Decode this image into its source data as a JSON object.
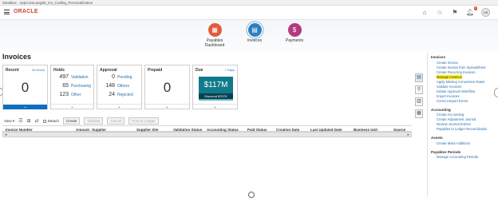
{
  "sandbox": {
    "label": "Sandbox",
    "name": "AppCoreLang3E_Inv_Coding_Personalization"
  },
  "header": {
    "logo": "ORACLE",
    "notif_count": "6",
    "avatar": "NB"
  },
  "tiles": [
    {
      "label": "Payables Dashboard",
      "color": "#e05c3c",
      "icon": "▦"
    },
    {
      "label": "Invoices",
      "color": "#2f7fbf",
      "icon": "▤",
      "active": true
    },
    {
      "label": "Payments",
      "color": "#b33a7e",
      "icon": "$"
    }
  ],
  "page_title": "Invoices",
  "cards": {
    "recent": {
      "title": "Recent",
      "link": "24 Hours",
      "value": "0"
    },
    "holds": {
      "title": "Holds",
      "rows": [
        {
          "num": "497",
          "label": "Validation"
        },
        {
          "num": "65",
          "label": "Purchasing"
        },
        {
          "num": "123",
          "label": "Other"
        }
      ]
    },
    "approval": {
      "title": "Approval",
      "rows": [
        {
          "num": "0",
          "label": "Pending"
        },
        {
          "num": "148",
          "label": "Others"
        },
        {
          "num": "24",
          "label": "Rejected"
        }
      ]
    },
    "prepaid": {
      "title": "Prepaid",
      "value": "0"
    },
    "due": {
      "title": "Due",
      "link": "7 Days",
      "amount": "$117M",
      "discount": "Discount $707K"
    }
  },
  "toolbar": {
    "view": "View ▾",
    "detach": "Detach",
    "create": "Create",
    "validate": "Validate",
    "cancel": "Cancel",
    "post": "Post to Ledger"
  },
  "table": {
    "columns": [
      "Invoice Number",
      "Amount",
      "Supplier",
      "Supplier Site",
      "Validation Status",
      "Accounting Status",
      "Paid Status",
      "Creation Date",
      "Last Updated Date",
      "Business Unit",
      "Source"
    ]
  },
  "side_panel": {
    "sections": [
      {
        "title": "Invoices",
        "links": [
          "Create Invoice",
          "Create Invoice from Spreadsheet",
          "Create Recurring Invoices",
          "Manage Invoices",
          "Apply Missing Conversion Rates",
          "Validate Invoices",
          "Initiate Approval Workflow",
          "Import Invoices",
          "Correct Import Errors"
        ],
        "highlight": 3
      },
      {
        "title": "Accounting",
        "links": [
          "Create Accounting",
          "Create Adjustment Journal",
          "Review Journal Entries",
          "Payables to Ledger Reconciliation"
        ]
      },
      {
        "title": "Assets",
        "links": [
          "Create Mass Additions"
        ]
      },
      {
        "title": "Payables Periods",
        "links": [
          "Manage Accounting Periods"
        ]
      }
    ]
  }
}
